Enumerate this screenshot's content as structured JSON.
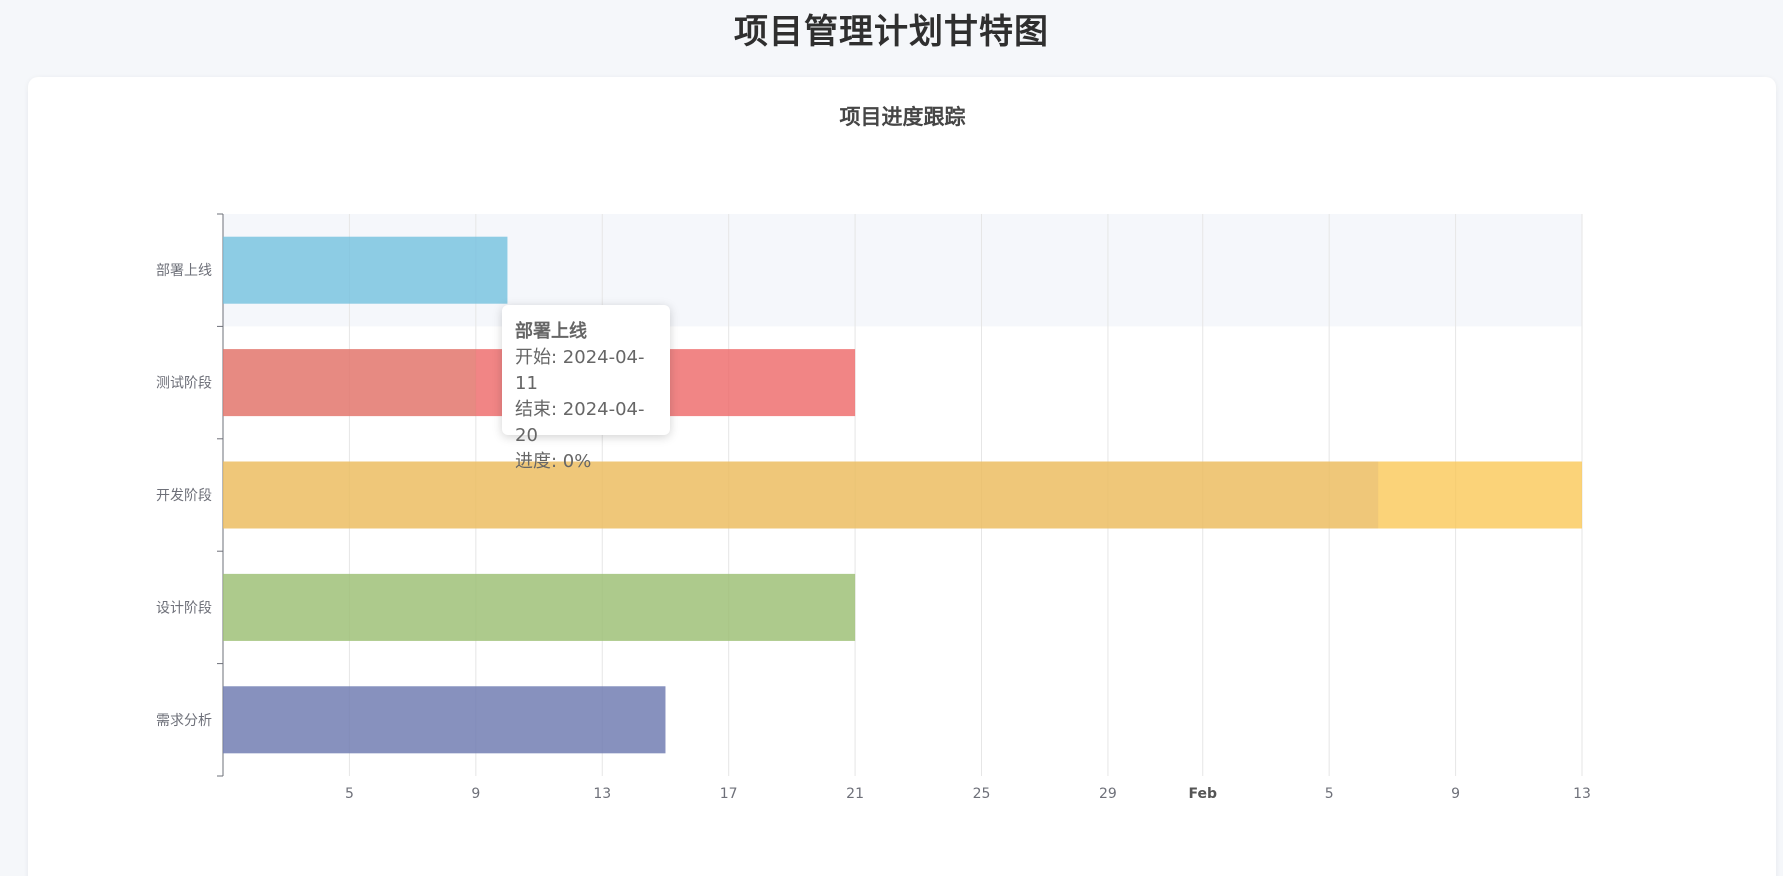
{
  "page": {
    "title": "项目管理计划甘特图"
  },
  "chart_data": {
    "type": "bar",
    "subtype": "gantt",
    "title": "项目进度跟踪",
    "x_axis": {
      "type": "time",
      "start": "2024-01-01",
      "end": "2024-02-13",
      "tick_labels": [
        "5",
        "9",
        "13",
        "17",
        "21",
        "25",
        "29",
        "Feb",
        "5",
        "9",
        "13"
      ],
      "tick_dates": [
        "2024-01-05",
        "2024-01-09",
        "2024-01-13",
        "2024-01-17",
        "2024-01-21",
        "2024-01-25",
        "2024-01-29",
        "2024-02-01",
        "2024-02-05",
        "2024-02-09",
        "2024-02-13"
      ],
      "grid": true
    },
    "categories": [
      "部署上线",
      "测试阶段",
      "开发阶段",
      "设计阶段",
      "需求分析"
    ],
    "tasks": [
      {
        "name": "部署上线",
        "start": "2024-01-01",
        "end": "2024-01-10",
        "progress": 0,
        "color": "#73c0de"
      },
      {
        "name": "测试阶段",
        "start": "2024-01-01",
        "end": "2024-01-21",
        "progress": 40,
        "color": "#ee6666"
      },
      {
        "name": "开发阶段",
        "start": "2024-01-01",
        "end": "2024-02-13",
        "progress": 85,
        "color": "#fac858"
      },
      {
        "name": "设计阶段",
        "start": "2024-01-01",
        "end": "2024-01-21",
        "progress": 100,
        "color": "#91cc75"
      },
      {
        "name": "需求分析",
        "start": "2024-01-01",
        "end": "2024-01-15",
        "progress": 100,
        "color": "#5470c6"
      }
    ],
    "highlighted_category": "部署上线",
    "tooltip": {
      "title": "部署上线",
      "start_label": "开始: 2024-04-11",
      "end_label": "结束: 2024-04-20",
      "progress_label": "进度: 0%"
    }
  }
}
